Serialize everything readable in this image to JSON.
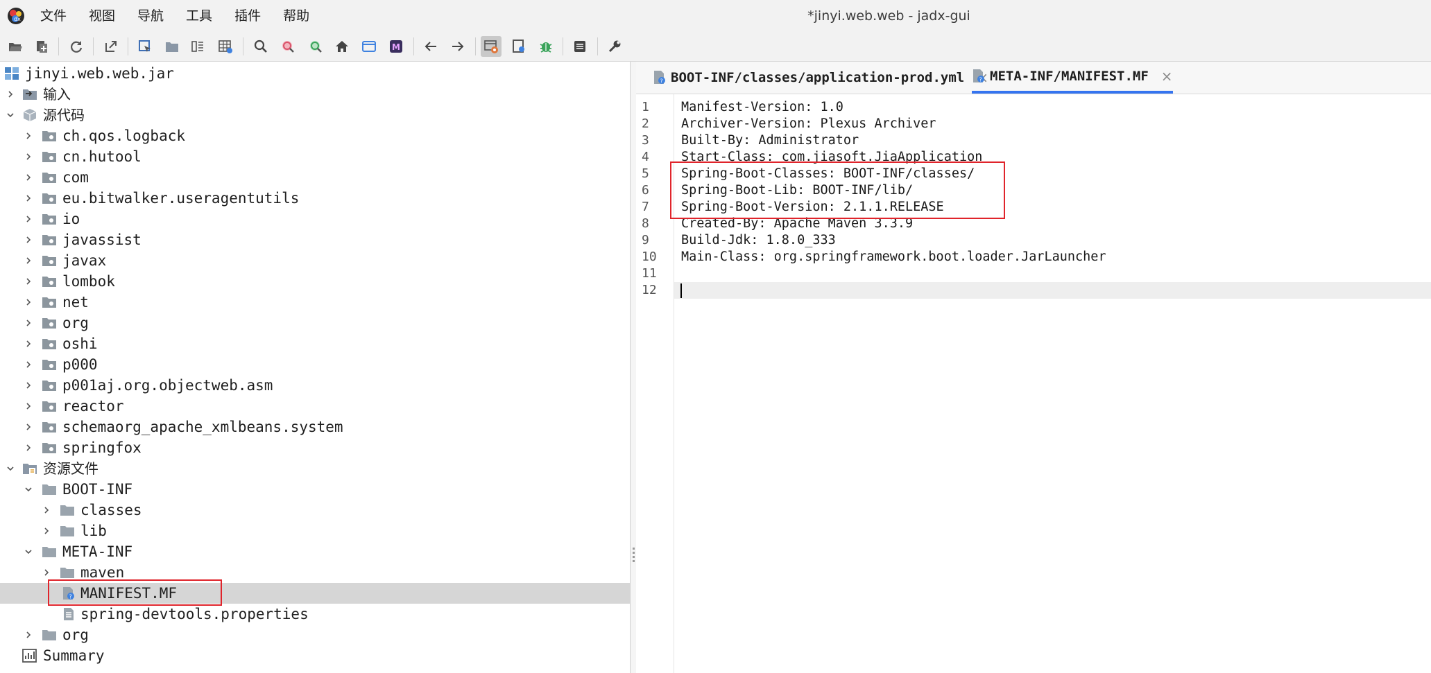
{
  "window": {
    "title": "*jinyi.web.web - jadx-gui"
  },
  "menu": [
    "文件",
    "视图",
    "导航",
    "工具",
    "插件",
    "帮助"
  ],
  "toolbar": [
    {
      "name": "open-file-icon"
    },
    {
      "name": "add-files-icon"
    },
    {
      "name": "reload-icon"
    },
    {
      "name": "export-icon"
    },
    {
      "name": "sync-tree-icon"
    },
    {
      "name": "flatten-packages-icon"
    },
    {
      "name": "split-view-icon"
    },
    {
      "name": "table-icon"
    },
    {
      "name": "search-icon"
    },
    {
      "name": "find-class-icon"
    },
    {
      "name": "find-usage-icon"
    },
    {
      "name": "home-icon"
    },
    {
      "name": "window-icon"
    },
    {
      "name": "mapping-icon"
    },
    {
      "name": "back-icon"
    },
    {
      "name": "forward-icon"
    },
    {
      "name": "deobfuscation-icon"
    },
    {
      "name": "quick-tab-icon"
    },
    {
      "name": "debug-icon"
    },
    {
      "name": "log-icon"
    },
    {
      "name": "preferences-icon"
    }
  ],
  "tree": {
    "root": "jinyi.web.web.jar",
    "input": "输入",
    "source": "源代码",
    "packages": [
      "ch.qos.logback",
      "cn.hutool",
      "com",
      "eu.bitwalker.useragentutils",
      "io",
      "javassist",
      "javax",
      "lombok",
      "net",
      "org",
      "oshi",
      "p000",
      "p001aj.org.objectweb.asm",
      "reactor",
      "schemaorg_apache_xmlbeans.system",
      "springfox"
    ],
    "resources": "资源文件",
    "boot_inf": "BOOT-INF",
    "classes": "classes",
    "lib": "lib",
    "meta_inf": "META-INF",
    "maven": "maven",
    "manifest": "MANIFEST.MF",
    "devtools": "spring-devtools.properties",
    "org": "org",
    "summary": "Summary"
  },
  "tabs": [
    {
      "label": "BOOT-INF/classes/application-prod.yml",
      "close": "×",
      "active": false
    },
    {
      "label": "META-INF/MANIFEST.MF",
      "close": "×",
      "active": true
    }
  ],
  "editor": {
    "line_numbers": [
      "1",
      "2",
      "3",
      "4",
      "5",
      "6",
      "7",
      "8",
      "9",
      "10",
      "11",
      "12"
    ],
    "lines": [
      "Manifest-Version: 1.0",
      "Archiver-Version: Plexus Archiver",
      "Built-By: Administrator",
      "Start-Class: com.jiasoft.JiaApplication",
      "Spring-Boot-Classes: BOOT-INF/classes/",
      "Spring-Boot-Lib: BOOT-INF/lib/",
      "Spring-Boot-Version: 2.1.1.RELEASE",
      "Created-By: Apache Maven 3.3.9",
      "Build-Jdk: 1.8.0_333",
      "Main-Class: org.springframework.boot.loader.JarLauncher",
      "",
      ""
    ]
  },
  "colors": {
    "highlight_border": "#e0242b",
    "accent_tab": "#3574f0",
    "selected_row": "#d6d6d6",
    "folder": "#9aa4ad",
    "package": "#8c969e"
  }
}
